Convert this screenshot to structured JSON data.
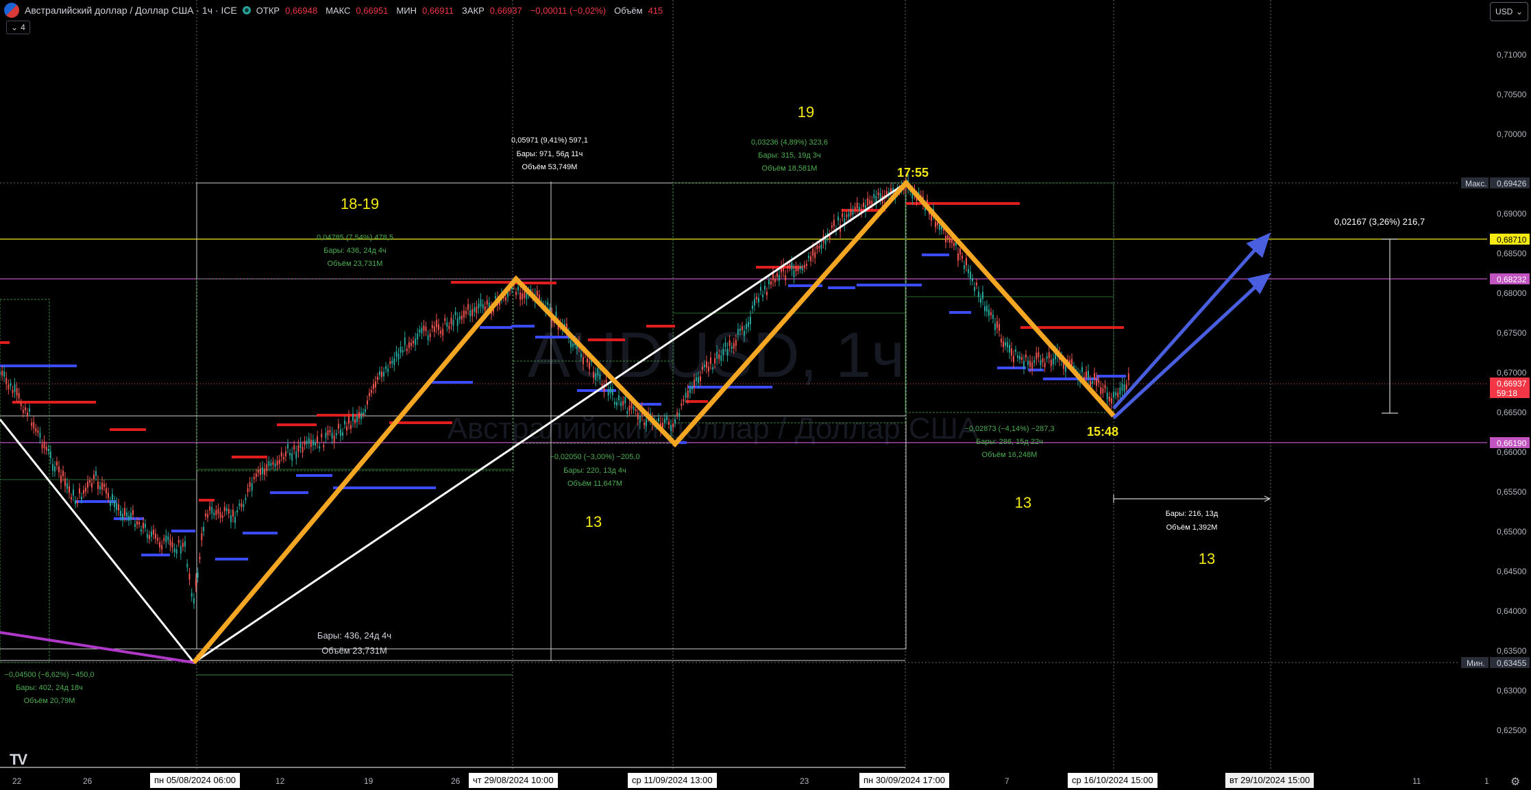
{
  "header": {
    "title": "Австралийский доллар / Доллар США · 1ч · ICE",
    "ohlc": [
      {
        "label": "ОТКР",
        "value": "0,66948"
      },
      {
        "label": "МАКС",
        "value": "0,66951"
      },
      {
        "label": "МИН",
        "value": "0,66911"
      },
      {
        "label": "ЗАКР",
        "value": "0,66937"
      },
      {
        "label": "",
        "value": "−0,00011 (−0,02%)"
      },
      {
        "label": "Объём",
        "value": "415"
      }
    ],
    "indicators_toggle": "4",
    "currency": "USD"
  },
  "watermark": {
    "symbol": "AUDUSD, 1ч",
    "name": "Австралийский доллар / Доллар США"
  },
  "price_axis": {
    "ticks": [
      "0,71000",
      "0,70500",
      "0,70000",
      "0,69000",
      "0,68500",
      "0,68000",
      "0,67500",
      "0,67000",
      "0,66500",
      "0,66000",
      "0,65500",
      "0,65000",
      "0,64500",
      "0,64000",
      "0,63500",
      "0,63000",
      "0,62500"
    ],
    "max_label": "Макс.",
    "max_price": "0,69426",
    "min_label": "Мин.",
    "min_price": "0,63455",
    "level_yellow": "0,68710",
    "level_purple_1": "0,68232",
    "level_purple_2": "0,66190",
    "last_price": "0,66937",
    "countdown": "59:18"
  },
  "time_axis": {
    "ticks": [
      "22",
      "26",
      "12",
      "19",
      "26",
      "23",
      "7",
      "11",
      "1"
    ],
    "tags": [
      "пн 05/08/2024   06:00",
      "чт 29/08/2024   10:00",
      "ср 11/09/2024   13:00",
      "пн 30/09/2024   17:00",
      "ср 16/10/2024   15:00",
      "вт 29/10/2024   15:00"
    ]
  },
  "annotations": {
    "wave_labels": [
      "18-19",
      "19",
      "13",
      "13",
      "13"
    ],
    "time_labels": [
      "17:55",
      "15:48"
    ],
    "m1": [
      "0,05971 (9,41%) 597,1",
      "Бары: 971, 56д 11ч",
      "Объём 53,749M"
    ],
    "m2": [
      "0,04785 (7,54%) 478,5",
      "Бары: 436, 24д 4ч",
      "Объём 23,731M"
    ],
    "m3": [
      "0,03236 (4,89%) 323,6",
      "Бары: 315, 19д 3ч",
      "Объём 18,581M"
    ],
    "m4": [
      "−0,02050 (−3,00%) −205,0",
      "Бары: 220, 13д 4ч",
      "Объём 11,647M"
    ],
    "m5": [
      "−0,02873 (−4,14%) −287,3",
      "Бары: 286, 15д 22ч",
      "Объём 16,248M"
    ],
    "m6": [
      "−0,04500 (−6,62%) −450,0",
      "Бары: 402, 24д 18ч",
      "Объём 20,79M"
    ],
    "m7": [
      "Бары: 436, 24д 4ч",
      "Объём 23,731M"
    ],
    "m8": [
      "Бары: 216, 13д",
      "Объём 1,392M"
    ],
    "m9": "0,02167 (3,26%) 216,7"
  },
  "colors": {
    "bg": "#000000",
    "orange": "#f5a623",
    "white": "#ffffff",
    "blue": "#4a5fe0",
    "yellow_text": "#f5ea14",
    "green_measure": "#4caf50",
    "red_level": "#e01e1e",
    "blue_level": "#3b4cff",
    "purple_line": "#c154c1",
    "up": "#26a69a",
    "down": "#ef5350"
  }
}
